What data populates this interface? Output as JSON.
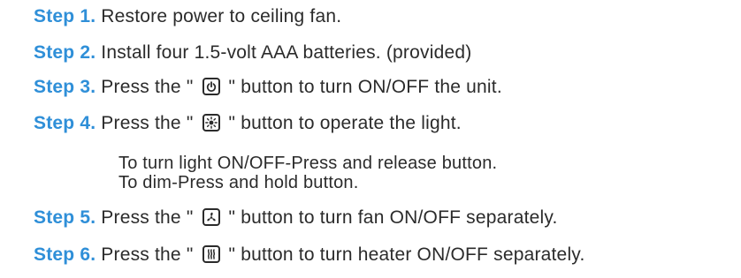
{
  "steps": [
    {
      "label": "Step 1.",
      "text": " Restore power to ceiling fan."
    },
    {
      "label": "Step 2.",
      "text": " Install four 1.5-volt AAA batteries. (provided)"
    },
    {
      "label": "Step 3.",
      "before": " Press the \"",
      "icon": "power-icon",
      "after": "\" button to turn ON/OFF the unit."
    },
    {
      "label": "Step 4.",
      "before": " Press the \"",
      "icon": "light-icon",
      "after": "\" button to operate the light."
    },
    {
      "label": "Step 5.",
      "before": " Press the \"",
      "icon": "fan-icon",
      "after": "\" button to turn fan ON/OFF separately."
    },
    {
      "label": "Step 6.",
      "before": " Press the \"",
      "icon": "heater-icon",
      "after": "\" button to turn heater ON/OFF separately."
    }
  ],
  "light_notes": [
    "To turn light ON/OFF-Press and release button.",
    "To dim-Press and hold button."
  ],
  "colors": {
    "step_label": "#2f8fd8",
    "body_text": "#2b2b2b"
  }
}
